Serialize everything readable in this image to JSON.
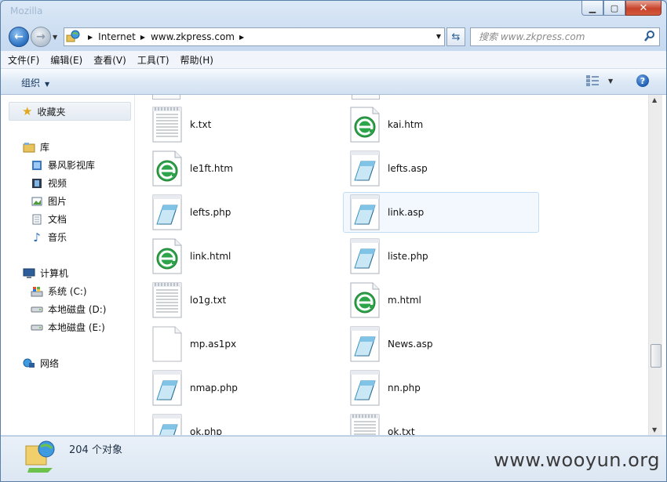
{
  "window": {
    "title": "Mozilla"
  },
  "address": {
    "crumbs": [
      "Internet",
      "www.zkpress.com"
    ],
    "search_placeholder": "搜索 www.zkpress.com"
  },
  "menu": [
    "文件(F)",
    "编辑(E)",
    "查看(V)",
    "工具(T)",
    "帮助(H)"
  ],
  "toolbar": {
    "organize": "组织"
  },
  "sidebar": {
    "favorites": "收藏夹",
    "library": "库",
    "library_items": [
      "暴风影视库",
      "视频",
      "图片",
      "文档",
      "音乐"
    ],
    "computer": "计算机",
    "drives": [
      "系统 (C:)",
      "本地磁盘 (D:)",
      "本地磁盘 (E:)"
    ],
    "network": "网络"
  },
  "files": [
    {
      "name": "k.txt",
      "icon": "text-file-icon"
    },
    {
      "name": "kai.htm",
      "icon": "ie-html-icon"
    },
    {
      "name": "le1ft.htm",
      "icon": "ie-html-icon"
    },
    {
      "name": "lefts.asp",
      "icon": "script-file-icon"
    },
    {
      "name": "lefts.php",
      "icon": "script-file-icon"
    },
    {
      "name": "link.asp",
      "icon": "script-file-icon",
      "selected": true
    },
    {
      "name": "link.html",
      "icon": "ie-html-icon"
    },
    {
      "name": "liste.php",
      "icon": "script-file-icon"
    },
    {
      "name": "lo1g.txt",
      "icon": "text-file-icon"
    },
    {
      "name": "m.html",
      "icon": "ie-html-icon"
    },
    {
      "name": "mp.as1px",
      "icon": "blank-file-icon"
    },
    {
      "name": "News.asp",
      "icon": "script-file-icon"
    },
    {
      "name": "nmap.php",
      "icon": "script-file-icon"
    },
    {
      "name": "nn.php",
      "icon": "script-file-icon"
    },
    {
      "name": "ok.php",
      "icon": "script-file-icon"
    },
    {
      "name": "ok.txt",
      "icon": "text-file-icon"
    }
  ],
  "status": {
    "count": "204 个对象"
  },
  "watermark": "www.wooyun.org"
}
